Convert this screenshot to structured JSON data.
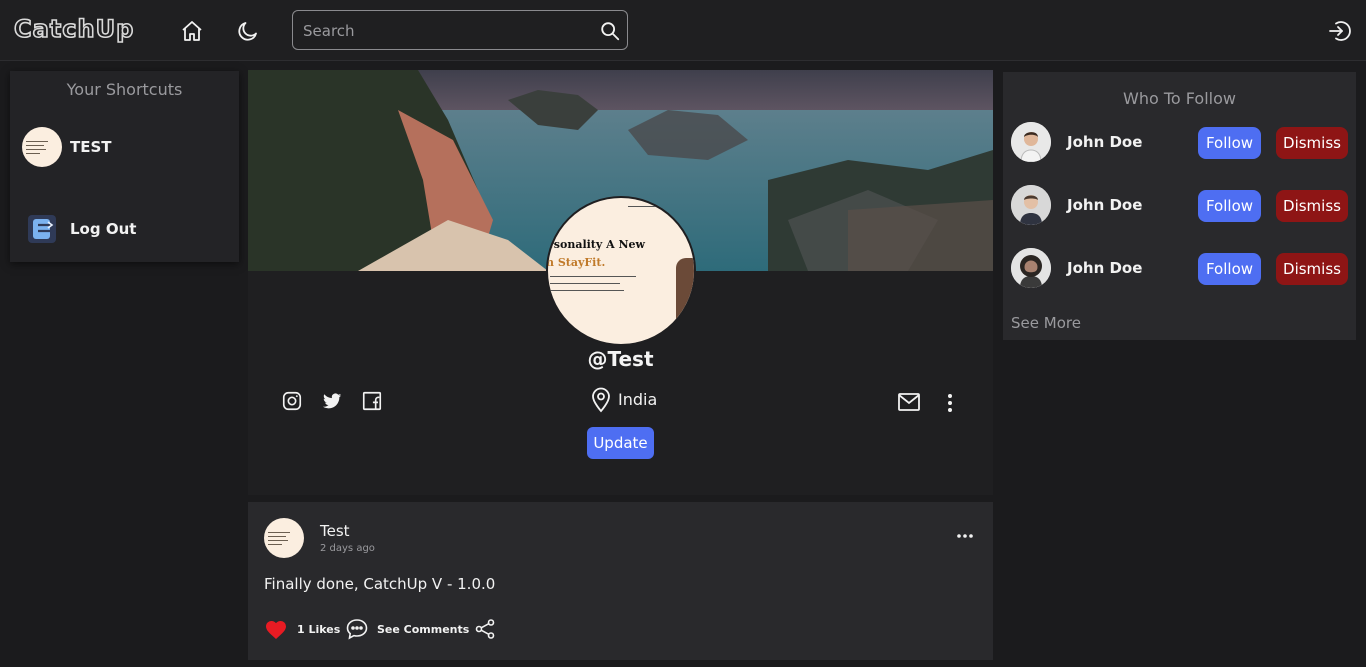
{
  "app": {
    "logo": "CatchUp"
  },
  "navbar": {
    "search_placeholder": "Search"
  },
  "shortcuts": {
    "title": "Your Shortcuts",
    "items": [
      {
        "label": "TEST"
      },
      {
        "label": "Log Out"
      }
    ]
  },
  "profile": {
    "username": "@Test",
    "location": "India",
    "update_label": "Update",
    "avatar_text": [
      "rsonality A New",
      "h StayFit."
    ]
  },
  "post": {
    "author": "Test",
    "time": "2 days ago",
    "text": "Finally done, CatchUp V - 1.0.0",
    "likes": "1 Likes",
    "comments_label": "See Comments"
  },
  "who_to_follow": {
    "title": "Who To Follow",
    "users": [
      {
        "name": "John Doe",
        "follow": "Follow",
        "dismiss": "Dismiss"
      },
      {
        "name": "John Doe",
        "follow": "Follow",
        "dismiss": "Dismiss"
      },
      {
        "name": "John Doe",
        "follow": "Follow",
        "dismiss": "Dismiss"
      }
    ],
    "see_more": "See More"
  },
  "colors": {
    "background": "#1b1b1d",
    "card": "#29292c",
    "accent": "#4e6ef2",
    "danger": "#8e1515",
    "like": "#e81b23"
  },
  "icons": [
    "home-icon",
    "moon-icon",
    "search-icon",
    "logout-icon",
    "instagram-icon",
    "twitter-icon",
    "facebook-icon",
    "location-pin-icon",
    "mail-icon",
    "more-vertical-icon",
    "more-horizontal-icon",
    "heart-icon",
    "comment-icon",
    "share-icon"
  ]
}
